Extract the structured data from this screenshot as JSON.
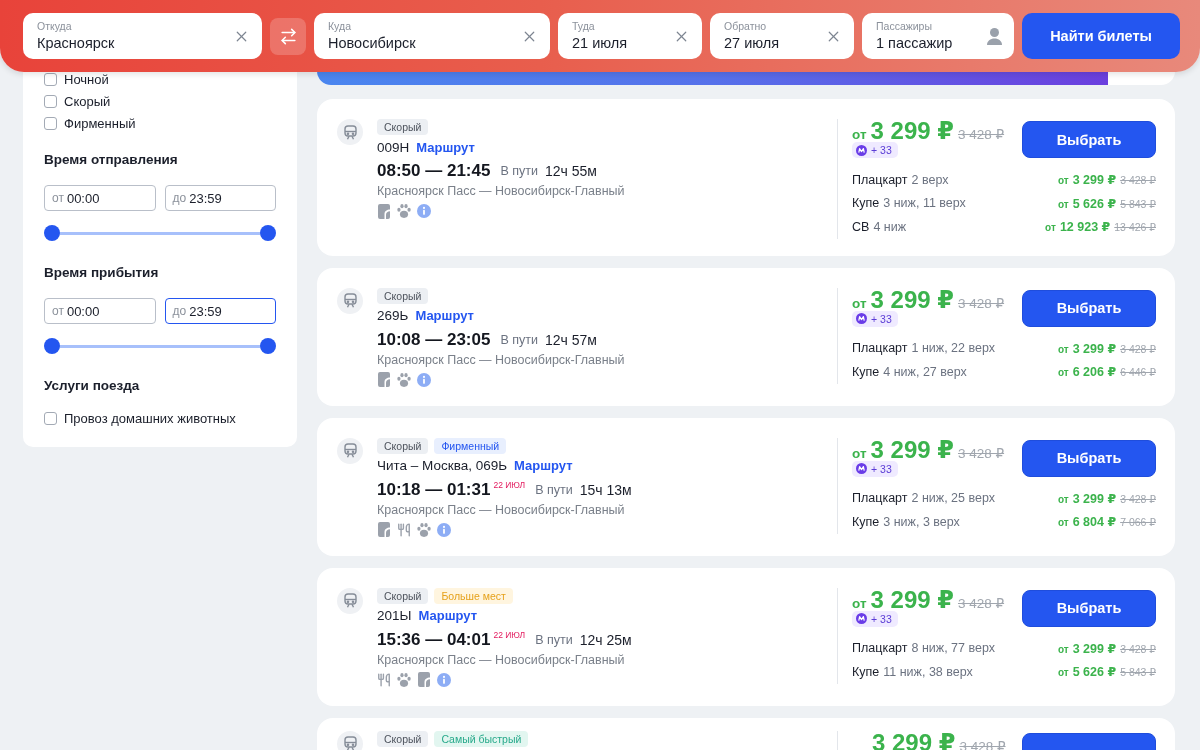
{
  "search_bar": {
    "from": {
      "label": "Откуда",
      "value": "Красноярск"
    },
    "to": {
      "label": "Куда",
      "value": "Новосибирск"
    },
    "dates": [
      {
        "label": "Туда",
        "value": "21 июля"
      },
      {
        "label": "Обратно",
        "value": "27 июля"
      }
    ],
    "passengers": {
      "label": "Пассажиры",
      "value": "1 пассажир"
    },
    "submit": "Найти билеты"
  },
  "filters": {
    "train_types": [
      {
        "label": "Ночной",
        "checked": false
      },
      {
        "label": "Скорый",
        "checked": false
      },
      {
        "label": "Фирменный",
        "checked": false
      }
    ],
    "time_ranges": [
      {
        "title": "Время отправления",
        "inputs": [
          {
            "prefix": "от",
            "value": "00:00",
            "focused": false
          },
          {
            "prefix": "до",
            "value": "23:59",
            "focused": false
          }
        ],
        "thumbs": [
          {
            "level": 0
          },
          {
            "level": 1
          }
        ]
      },
      {
        "title": "Время прибытия",
        "inputs": [
          {
            "prefix": "от",
            "value": "00:00",
            "focused": false
          },
          {
            "prefix": "до",
            "value": "23:59",
            "focused": true
          }
        ],
        "thumbs": [
          {
            "level": 0
          },
          {
            "level": 1
          }
        ]
      }
    ],
    "services": {
      "title": "Услуги поезда",
      "options": [
        {
          "label": "Провоз домашних животных",
          "checked": false
        }
      ]
    }
  },
  "trains": [
    {
      "badges": [
        {
          "label": "Скорый",
          "kind": "type"
        }
      ],
      "number": "009Н",
      "route_link": "Маршрут",
      "time_range": "08:50 — 21:45",
      "travel_label": "В пути",
      "duration": "12ч 55м",
      "stations": "Красноярск Пасс — Новосибирск-Главный",
      "amenities": [
        {
          "kind": "linen"
        },
        {
          "kind": "paw"
        },
        {
          "kind": "info"
        }
      ],
      "price": {
        "prefix": "от",
        "value": "3 299 ₽",
        "old": "3 428 ₽"
      },
      "bonus": "+ 33",
      "button": "Выбрать",
      "classes": [
        {
          "name": "Плацкарт",
          "seats": "2 верх",
          "prefix": "от",
          "price": "3 299 ₽",
          "old_price": "3 428 ₽"
        },
        {
          "name": "Купе",
          "seats": "3 ниж, 11 верх",
          "prefix": "от",
          "price": "5 626 ₽",
          "old_price": "5 843 ₽"
        },
        {
          "name": "СВ",
          "seats": "4 ниж",
          "prefix": "от",
          "price": "12 923 ₽",
          "old_price": "13 426 ₽"
        }
      ]
    },
    {
      "badges": [
        {
          "label": "Скорый",
          "kind": "type"
        }
      ],
      "number": "269Ь",
      "route_link": "Маршрут",
      "time_range": "10:08 — 23:05",
      "travel_label": "В пути",
      "duration": "12ч 57м",
      "stations": "Красноярск Пасс — Новосибирск-Главный",
      "amenities": [
        {
          "kind": "linen"
        },
        {
          "kind": "paw"
        },
        {
          "kind": "info"
        }
      ],
      "price": {
        "prefix": "от",
        "value": "3 299 ₽",
        "old": "3 428 ₽"
      },
      "bonus": "+ 33",
      "button": "Выбрать",
      "classes": [
        {
          "name": "Плацкарт",
          "seats": "1 ниж, 22 верх",
          "prefix": "от",
          "price": "3 299 ₽",
          "old_price": "3 428 ₽"
        },
        {
          "name": "Купе",
          "seats": "4 ниж, 27 верх",
          "prefix": "от",
          "price": "6 206 ₽",
          "old_price": "6 446 ₽"
        }
      ]
    },
    {
      "badges": [
        {
          "label": "Скорый",
          "kind": "type"
        },
        {
          "label": "Фирменный",
          "kind": "brand"
        }
      ],
      "number": "Чита – Москва, 069Ь",
      "route_link": "Маршрут",
      "time_range": "10:18 — 01:31",
      "arrival_date": "22 ИЮЛ",
      "travel_label": "В пути",
      "duration": "15ч 13м",
      "stations": "Красноярск Пасс — Новосибирск-Главный",
      "amenities": [
        {
          "kind": "linen"
        },
        {
          "kind": "cutlery"
        },
        {
          "kind": "paw"
        },
        {
          "kind": "info"
        }
      ],
      "price": {
        "prefix": "от",
        "value": "3 299 ₽",
        "old": "3 428 ₽"
      },
      "bonus": "+ 33",
      "button": "Выбрать",
      "classes": [
        {
          "name": "Плацкарт",
          "seats": "2 ниж, 25 верх",
          "prefix": "от",
          "price": "3 299 ₽",
          "old_price": "3 428 ₽"
        },
        {
          "name": "Купе",
          "seats": "3 ниж, 3 верх",
          "prefix": "от",
          "price": "6 804 ₽",
          "old_price": "7 066 ₽"
        }
      ]
    },
    {
      "badges": [
        {
          "label": "Скорый",
          "kind": "type"
        },
        {
          "label": "Больше мест",
          "kind": "more_seats"
        }
      ],
      "number": "201Ы",
      "route_link": "Маршрут",
      "time_range": "15:36 — 04:01",
      "arrival_date": "22 ИЮЛ",
      "travel_label": "В пути",
      "duration": "12ч 25м",
      "stations": "Красноярск Пасс — Новосибирск-Главный",
      "amenities": [
        {
          "kind": "cutlery"
        },
        {
          "kind": "paw"
        },
        {
          "kind": "linen"
        },
        {
          "kind": "info"
        }
      ],
      "price": {
        "prefix": "от",
        "value": "3 299 ₽",
        "old": "3 428 ₽"
      },
      "bonus": "+ 33",
      "button": "Выбрать",
      "classes": [
        {
          "name": "Плацкарт",
          "seats": "8 ниж, 77 верх",
          "prefix": "от",
          "price": "3 299 ₽",
          "old_price": "3 428 ₽"
        },
        {
          "name": "Купе",
          "seats": "11 ниж, 38 верх",
          "prefix": "от",
          "price": "5 626 ₽",
          "old_price": "5 843 ₽"
        }
      ]
    }
  ],
  "next_train": {
    "badges": [
      {
        "label": "Скорый",
        "kind": "type"
      },
      {
        "label": "Самый быстрый",
        "kind": "fastest"
      }
    ],
    "price": "3 299 ₽",
    "old_price": "3 428 ₽"
  }
}
